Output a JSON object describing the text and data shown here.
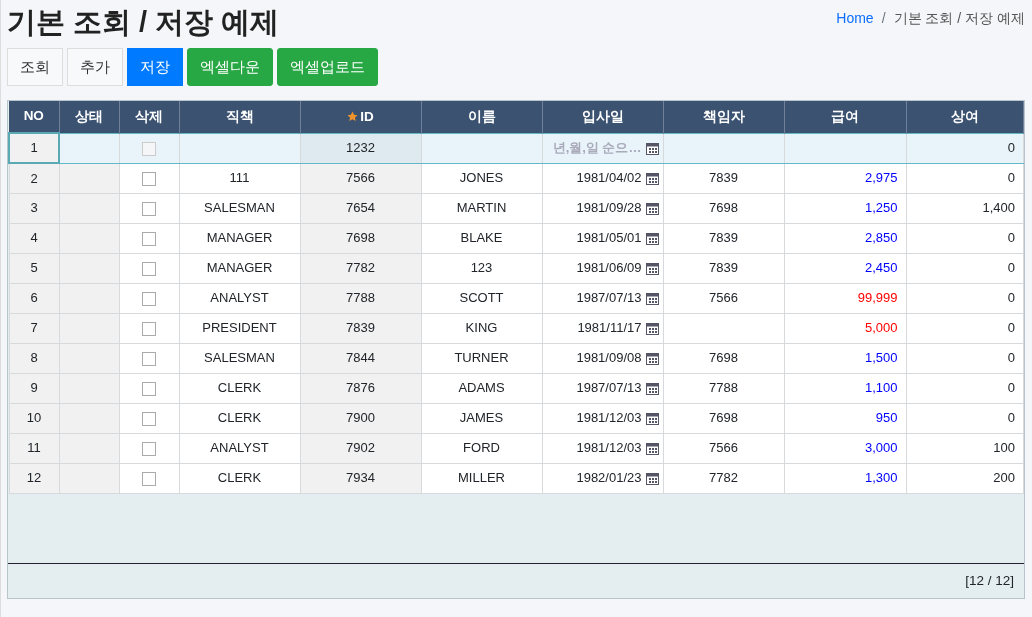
{
  "page_title": "기본 조회 / 저장 예제",
  "breadcrumb": [
    {
      "label": "Home",
      "link": true
    },
    {
      "label": "기본 조회 / 저장 예제",
      "link": false
    }
  ],
  "breadcrumb_separator": "/",
  "toolbar": [
    {
      "label": "조회",
      "kind": "light"
    },
    {
      "label": "추가",
      "kind": "light"
    },
    {
      "label": "저장",
      "kind": "primary"
    },
    {
      "label": "엑셀다운",
      "kind": "success"
    },
    {
      "label": "엑셀업로드",
      "kind": "success"
    }
  ],
  "grid": {
    "columns": [
      {
        "label": "NO",
        "key": false
      },
      {
        "label": "상태",
        "key": false
      },
      {
        "label": "삭제",
        "key": false
      },
      {
        "label": "직책",
        "key": false
      },
      {
        "label": "ID",
        "key": true
      },
      {
        "label": "이름",
        "key": false
      },
      {
        "label": "입사일",
        "key": false
      },
      {
        "label": "책임자",
        "key": false
      },
      {
        "label": "급여",
        "key": false
      },
      {
        "label": "상여",
        "key": false
      }
    ],
    "rows": [
      {
        "no": "1",
        "selected": true,
        "deleted": false,
        "delete_disabled": true,
        "job": "",
        "id": "1232",
        "name": "",
        "hire_date": "",
        "hire_date_placeholder": "년,월,일 순으…",
        "manager": "",
        "salary": "",
        "bonus": "0"
      },
      {
        "no": "2",
        "selected": false,
        "deleted": false,
        "delete_disabled": false,
        "job": "111",
        "id": "7566",
        "name": "JONES",
        "hire_date": "1981/04/02",
        "manager": "7839",
        "salary": "2,975",
        "color": "#0000ff",
        "bonus": "0"
      },
      {
        "no": "3",
        "selected": false,
        "deleted": false,
        "delete_disabled": false,
        "job": "SALESMAN",
        "id": "7654",
        "name": "MARTIN",
        "hire_date": "1981/09/28",
        "manager": "7698",
        "salary": "1,250",
        "color": "#0000ff",
        "bonus": "1,400"
      },
      {
        "no": "4",
        "selected": false,
        "deleted": false,
        "delete_disabled": false,
        "job": "MANAGER",
        "id": "7698",
        "name": "BLAKE",
        "hire_date": "1981/05/01",
        "manager": "7839",
        "salary": "2,850",
        "color": "#0000ff",
        "bonus": "0"
      },
      {
        "no": "5",
        "selected": false,
        "deleted": false,
        "delete_disabled": false,
        "job": "MANAGER",
        "id": "7782",
        "name": "123",
        "hire_date": "1981/06/09",
        "manager": "7839",
        "salary": "2,450",
        "color": "#0000ff",
        "bonus": "0"
      },
      {
        "no": "6",
        "selected": false,
        "deleted": false,
        "delete_disabled": false,
        "job": "ANALYST",
        "id": "7788",
        "name": "SCOTT",
        "hire_date": "1987/07/13",
        "manager": "7566",
        "salary": "99,999",
        "color": "#ff0000",
        "bonus": "0"
      },
      {
        "no": "7",
        "selected": false,
        "deleted": false,
        "delete_disabled": false,
        "job": "PRESIDENT",
        "id": "7839",
        "name": "KING",
        "hire_date": "1981/11/17",
        "manager": "",
        "salary": "5,000",
        "color": "#ff0000",
        "bonus": "0"
      },
      {
        "no": "8",
        "selected": false,
        "deleted": false,
        "delete_disabled": false,
        "job": "SALESMAN",
        "id": "7844",
        "name": "TURNER",
        "hire_date": "1981/09/08",
        "manager": "7698",
        "salary": "1,500",
        "color": "#0000ff",
        "bonus": "0"
      },
      {
        "no": "9",
        "selected": false,
        "deleted": false,
        "delete_disabled": false,
        "job": "CLERK",
        "id": "7876",
        "name": "ADAMS",
        "hire_date": "1987/07/13",
        "manager": "7788",
        "salary": "1,100",
        "color": "#0000ff",
        "bonus": "0"
      },
      {
        "no": "10",
        "selected": false,
        "deleted": false,
        "delete_disabled": false,
        "job": "CLERK",
        "id": "7900",
        "name": "JAMES",
        "hire_date": "1981/12/03",
        "manager": "7698",
        "salary": "950",
        "color": "#0000ff",
        "bonus": "0"
      },
      {
        "no": "11",
        "selected": false,
        "deleted": false,
        "delete_disabled": false,
        "job": "ANALYST",
        "id": "7902",
        "name": "FORD",
        "hire_date": "1981/12/03",
        "manager": "7566",
        "salary": "3,000",
        "color": "#0000ff",
        "bonus": "100"
      },
      {
        "no": "12",
        "selected": false,
        "deleted": false,
        "delete_disabled": false,
        "job": "CLERK",
        "id": "7934",
        "name": "MILLER",
        "hire_date": "1982/01/23",
        "manager": "7782",
        "salary": "1,300",
        "color": "#0000ff",
        "bonus": "200"
      }
    ],
    "footer_count": "[12 / 12]"
  }
}
